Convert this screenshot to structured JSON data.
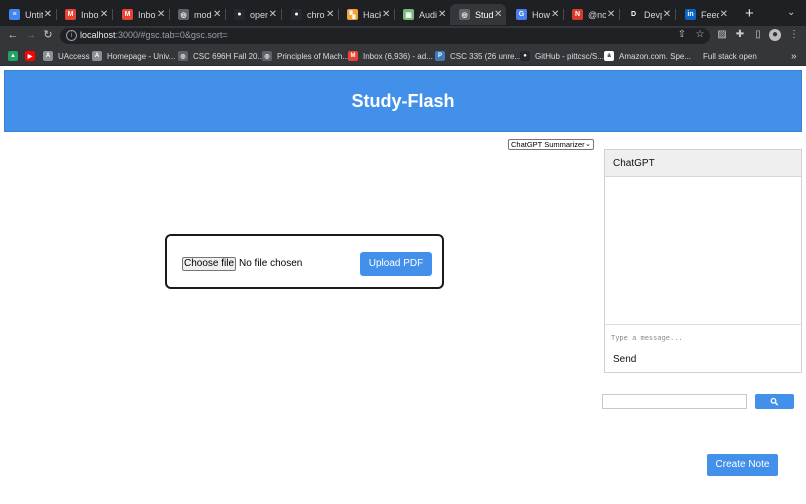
{
  "browser": {
    "tabs": [
      {
        "label": "Untitl",
        "icon": "docs-icon",
        "color": "#4285f4",
        "glyph": "≡"
      },
      {
        "label": "Inbox",
        "icon": "gmail-icon",
        "color": "#ea4335",
        "glyph": "M"
      },
      {
        "label": "Inbox",
        "icon": "gmail-icon",
        "color": "#ea4335",
        "glyph": "M"
      },
      {
        "label": "mode",
        "icon": "globe-icon",
        "color": "#5f6368",
        "glyph": "◎"
      },
      {
        "label": "open",
        "icon": "github-icon",
        "color": "#24292e",
        "glyph": "●"
      },
      {
        "label": "chron",
        "icon": "github-icon",
        "color": "#24292e",
        "glyph": "●"
      },
      {
        "label": "Hackl",
        "icon": "hackmd-icon",
        "color": "#f2a33a",
        "glyph": "▚"
      },
      {
        "label": "Audic",
        "icon": "audio-icon",
        "color": "#7cb87e",
        "glyph": "▣"
      },
      {
        "label": "Study",
        "icon": "globe-icon",
        "color": "#5f6368",
        "glyph": "◎",
        "active": true
      },
      {
        "label": "How t",
        "icon": "ai-icon",
        "color": "#4a7ef0",
        "glyph": "G"
      },
      {
        "label": "@not",
        "icon": "notion-icon",
        "color": "#d93a2b",
        "glyph": "N"
      },
      {
        "label": "Devp",
        "icon": "devpost-icon",
        "color": "#1f2024",
        "glyph": "D"
      },
      {
        "label": "Feed",
        "icon": "linkedin-icon",
        "color": "#0a66c2",
        "glyph": "in"
      }
    ],
    "url_host": "localhost",
    "url_rest": ":3000/#gsc.tab=0&gsc.sort=",
    "bookmarks": [
      {
        "label": "",
        "icon": "drive-icon",
        "color": "#1fa463",
        "glyph": "▲"
      },
      {
        "label": "",
        "icon": "youtube-icon",
        "color": "#ff0000",
        "glyph": "▶"
      },
      {
        "label": "UAccess",
        "icon": "university-icon",
        "color": "#8a8f98",
        "glyph": "A"
      },
      {
        "label": "Homepage - Univ...",
        "icon": "university-icon",
        "color": "#8a8f98",
        "glyph": "A"
      },
      {
        "label": "CSC 696H Fall 20...",
        "icon": "globe-icon",
        "color": "#5f6368",
        "glyph": "◎"
      },
      {
        "label": "Principles of Mach...",
        "icon": "globe-icon",
        "color": "#5f6368",
        "glyph": "◎"
      },
      {
        "label": "Inbox (6,936) - ad...",
        "icon": "gmail-icon",
        "color": "#ea4335",
        "glyph": "M"
      },
      {
        "label": "CSC 335 (26 unre...",
        "icon": "piazza-icon",
        "color": "#3e7ab8",
        "glyph": "P"
      },
      {
        "label": "GitHub - pittcsc/S...",
        "icon": "github-icon",
        "color": "#24292e",
        "glyph": "●"
      },
      {
        "label": "Amazon.com. Spe...",
        "icon": "amazon-icon",
        "color": "#ffffff",
        "glyph": "a"
      },
      {
        "label": "Full stack open",
        "icon": "",
        "color": "",
        "glyph": ""
      }
    ],
    "bookmarks_overflow": "»"
  },
  "page": {
    "title": "Study-Flash",
    "summarizer_select": "ChatGPT Summarizer",
    "choose_file_label": "Choose file",
    "no_file_text": "No file chosen",
    "upload_label": "Upload PDF",
    "chat": {
      "title": "ChatGPT",
      "input_placeholder": "Type a message...",
      "send_label": "Send"
    },
    "search_value": "",
    "create_note_label": "Create Note"
  },
  "colors": {
    "accent": "#4390ea",
    "chrome_dark": "#1f2024",
    "chrome_toolbar": "#35363a"
  }
}
